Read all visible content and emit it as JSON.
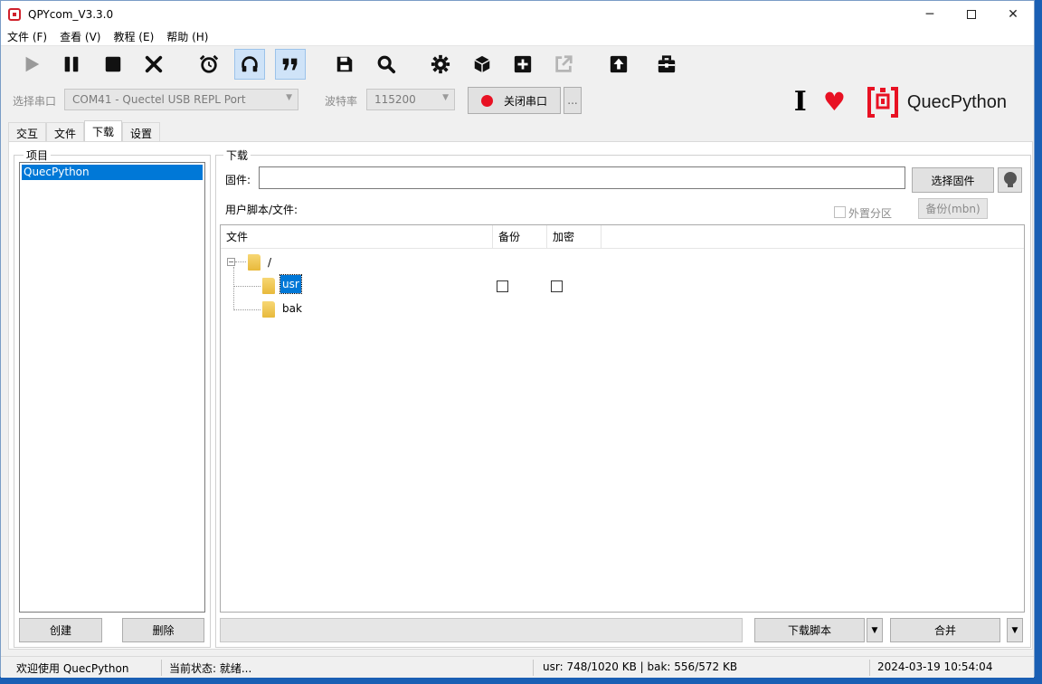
{
  "window": {
    "title": "QPYcom_V3.3.0"
  },
  "menu": [
    "文件 (F)",
    "查看 (V)",
    "教程 (E)",
    "帮助 (H)"
  ],
  "toolbar_icons": [
    "play-icon",
    "pause-icon",
    "stop-icon",
    "close-x-icon",
    "alarm-clock-icon",
    "headset-icon",
    "quote-icon",
    "save-disk-icon",
    "search-icon",
    "gear-icon",
    "cube-icon",
    "plus-box-icon",
    "external-link-icon",
    "upload-icon",
    "toolbox-icon"
  ],
  "port": {
    "label": "选择串口",
    "value": "COM41 - Quectel USB REPL Port",
    "baud_label": "波特率",
    "baud_value": "115200",
    "toggle_label": "关闭串口",
    "more_label": "..."
  },
  "brand": {
    "name": "QuecPython",
    "accent": "#e81123"
  },
  "tabs": [
    "交互",
    "文件",
    "下载",
    "设置"
  ],
  "project": {
    "title": "项目",
    "items": [
      "QuecPython"
    ],
    "create_label": "创建",
    "delete_label": "删除"
  },
  "download": {
    "title": "下载",
    "firmware_label": "固件:",
    "firmware_value": "",
    "select_fw_label": "选择固件",
    "user_scripts_label": "用户脚本/文件:",
    "external_partition_label": "外置分区",
    "backup_mbn_label": "备份(mbn)",
    "columns": [
      "文件",
      "备份",
      "加密"
    ],
    "tree": {
      "root": "/",
      "children": [
        "usr",
        "bak"
      ]
    },
    "download_script_label": "下载脚本",
    "merge_label": "合并"
  },
  "status": {
    "welcome": "欢迎使用 QuecPython",
    "state": "当前状态: 就绪...",
    "usage": "usr: 748/1020 KB | bak: 556/572 KB",
    "datetime": "2024-03-19 10:54:04"
  }
}
